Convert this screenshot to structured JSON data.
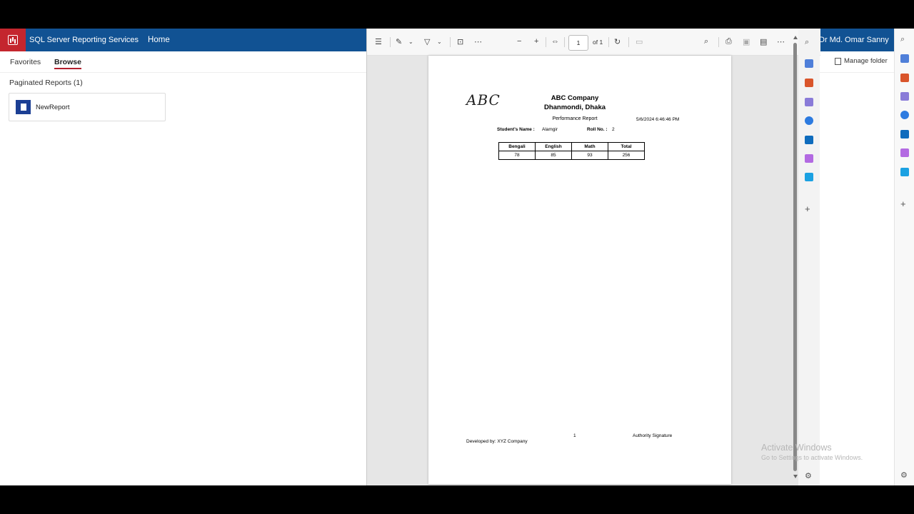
{
  "ssrs": {
    "app_title": "SQL Server Reporting Services",
    "home_link": "Home",
    "user_name": "Dr Md. Omar Sanny",
    "tabs": [
      "Favorites",
      "Browse"
    ],
    "active_tab": "Browse",
    "manage_folder": "Manage folder",
    "section_title": "Paginated Reports (1)",
    "reports": [
      {
        "name": "NewReport"
      }
    ],
    "brand_color": "#c4262e",
    "header_color": "#115293"
  },
  "pdf_viewer": {
    "page_current": "1",
    "page_total_label": "of 1",
    "toolbar_icons": [
      "contents-icon",
      "draw-icon",
      "highlight-icon",
      "text-icon",
      "more-icon",
      "zoom-out-icon",
      "zoom-in-icon",
      "fit-page-icon",
      "rotate-icon",
      "two-page-icon",
      "search-icon",
      "print-icon",
      "save-icon",
      "save-as-icon",
      "more-options-icon"
    ]
  },
  "report": {
    "logo_text": "ABC",
    "company_name": "ABC Company",
    "company_address": "Dhanmondi, Dhaka",
    "title": "Performance Report",
    "date": "5/6/2024 6:46:46 PM",
    "student_label": "Student's Name :",
    "student_name": "Alamgir",
    "roll_label": "Roll No. :",
    "roll_value": "2",
    "table_headers": [
      "Bengali",
      "English",
      "Math",
      "Total"
    ],
    "table_rows": [
      [
        "78",
        "85",
        "93",
        "256"
      ]
    ],
    "footer_left": "Developed by: XYZ Company",
    "footer_page": "1",
    "footer_right": "Authority Signature"
  },
  "os": {
    "watermark_title": "Activate Windows",
    "watermark_sub": "Go to Settings to activate Windows."
  }
}
